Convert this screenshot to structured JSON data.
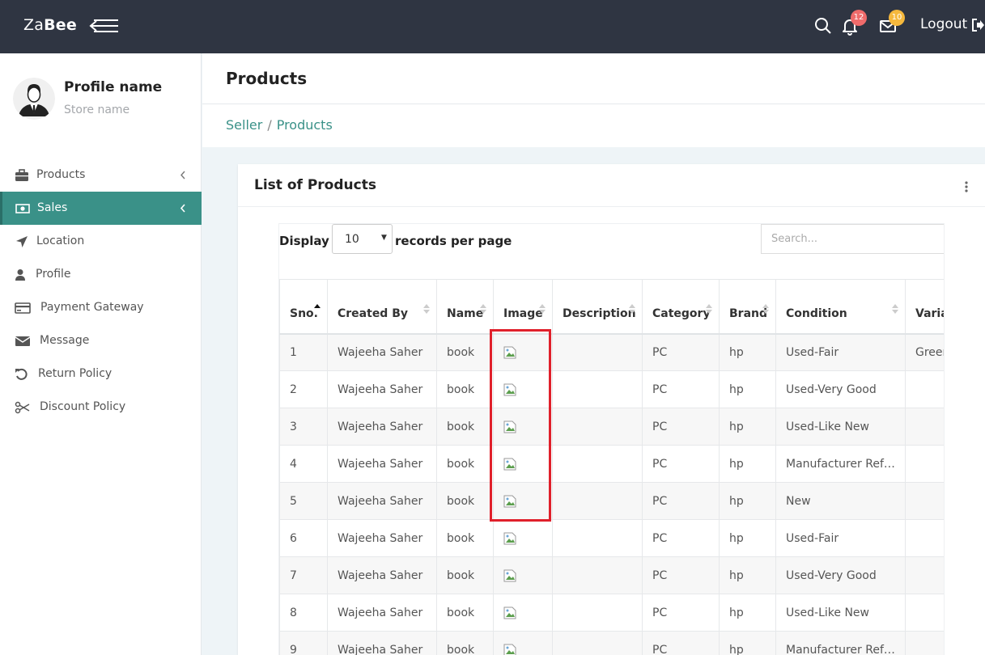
{
  "brand": {
    "prefix": "Za",
    "suffix": "Bee"
  },
  "topbar": {
    "notifications_count": "12",
    "messages_count": "10",
    "logout_label": "Logout",
    "colors": {
      "bg": "#2f3542",
      "notif_badge": "#ef6b6b",
      "msg_badge": "#f5b83d"
    }
  },
  "sidebar": {
    "profile_name": "Profile name",
    "store_name": "Store name",
    "items": [
      {
        "label": "Products",
        "icon": "briefcase-icon",
        "active": false,
        "chevron": true
      },
      {
        "label": "Sales",
        "icon": "money-icon",
        "active": true,
        "chevron": true
      },
      {
        "label": "Location",
        "icon": "location-arrow-icon",
        "active": false,
        "chevron": false
      },
      {
        "label": "Profile",
        "icon": "user-icon",
        "active": false,
        "chevron": false
      },
      {
        "label": "Payment Gateway",
        "icon": "credit-card-icon",
        "active": false,
        "chevron": false
      },
      {
        "label": "Message",
        "icon": "envelope-icon",
        "active": false,
        "chevron": false
      },
      {
        "label": "Return Policy",
        "icon": "undo-icon",
        "active": false,
        "chevron": false
      },
      {
        "label": "Discount Policy",
        "icon": "scissors-icon",
        "active": false,
        "chevron": false
      }
    ],
    "accent": "#3a9188"
  },
  "page": {
    "title": "Products",
    "breadcrumb": [
      "Seller",
      "Products"
    ]
  },
  "card": {
    "title": "List of Products",
    "display_label": "Display",
    "display_value": "10",
    "records_label": "records per page",
    "search_placeholder": "Search..."
  },
  "table": {
    "columns": [
      "Sno.",
      "Created By",
      "Name",
      "Image",
      "Description",
      "Category",
      "Brand",
      "Condition",
      "Variation"
    ],
    "rows": [
      [
        "1",
        "Wajeeha Saher",
        "book",
        "",
        "",
        "PC",
        "hp",
        "Used-Fair",
        "Green"
      ],
      [
        "2",
        "Wajeeha Saher",
        "book",
        "",
        "",
        "PC",
        "hp",
        "Used-Very Good",
        ""
      ],
      [
        "3",
        "Wajeeha Saher",
        "book",
        "",
        "",
        "PC",
        "hp",
        "Used-Like New",
        ""
      ],
      [
        "4",
        "Wajeeha Saher",
        "book",
        "",
        "",
        "PC",
        "hp",
        "Manufacturer Refurbished",
        ""
      ],
      [
        "5",
        "Wajeeha Saher",
        "book",
        "",
        "",
        "PC",
        "hp",
        "New",
        ""
      ],
      [
        "6",
        "Wajeeha Saher",
        "book",
        "",
        "",
        "PC",
        "hp",
        "Used-Fair",
        ""
      ],
      [
        "7",
        "Wajeeha Saher",
        "book",
        "",
        "",
        "PC",
        "hp",
        "Used-Very Good",
        ""
      ],
      [
        "8",
        "Wajeeha Saher",
        "book",
        "",
        "",
        "PC",
        "hp",
        "Used-Like New",
        ""
      ],
      [
        "9",
        "Wajeeha Saher",
        "book",
        "",
        "",
        "PC",
        "hp",
        "Manufacturer Refurbished",
        ""
      ]
    ]
  },
  "highlight_color": "#e0202b"
}
